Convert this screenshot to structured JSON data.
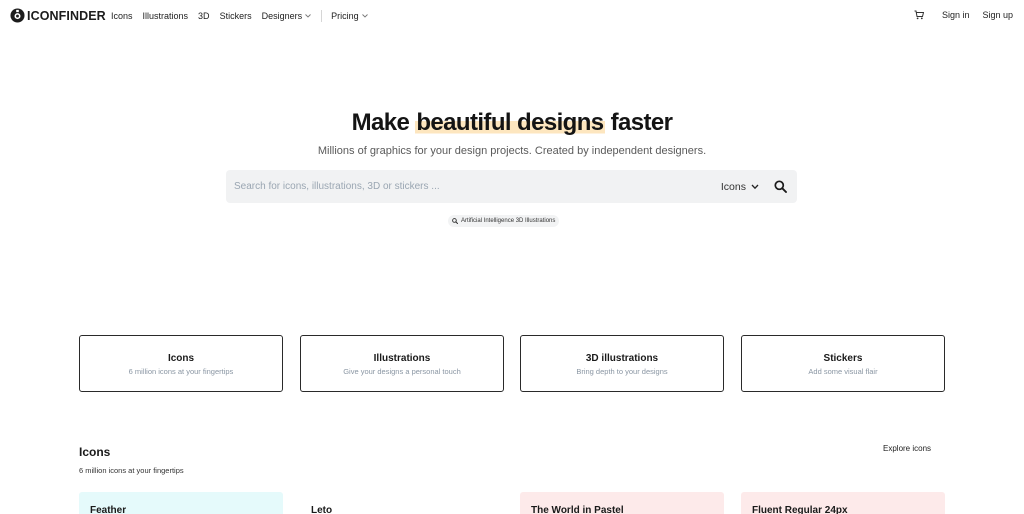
{
  "nav": {
    "logo_text": "ICONFINDER",
    "links": [
      {
        "label": "Icons"
      },
      {
        "label": "Illustrations"
      },
      {
        "label": "3D"
      },
      {
        "label": "Stickers"
      },
      {
        "label": "Designers"
      },
      {
        "label": "Pricing"
      }
    ],
    "signin": "Sign in",
    "signup": "Sign up"
  },
  "hero": {
    "title_pre": "Make ",
    "title_highlight": "beautiful designs",
    "title_post": " faster",
    "subtitle": "Millions of graphics for your design projects. Created by independent designers.",
    "highlight_color": "#fde6bf"
  },
  "search": {
    "placeholder": "Search for icons, illustrations, 3D or stickers ...",
    "value": "",
    "type_selected": "Icons",
    "suggestion": "Artificial Intelligence 3D Illustrations"
  },
  "categories": [
    {
      "title": "Icons",
      "desc": "6 million icons at your fingertips"
    },
    {
      "title": "Illustrations",
      "desc": "Give your designs a personal touch"
    },
    {
      "title": "3D illustrations",
      "desc": "Bring depth to your designs"
    },
    {
      "title": "Stickers",
      "desc": "Add some visual flair"
    }
  ],
  "icons_section": {
    "title": "Icons",
    "subtitle": "6 million icons at your fingertips",
    "explore": "Explore icons",
    "sets": [
      {
        "title": "Feather",
        "bg": "#e5fafb"
      },
      {
        "title": "Leto",
        "bg": "#ffffff"
      },
      {
        "title": "The World in Pastel",
        "bg": "#fdeaea"
      },
      {
        "title": "Fluent Regular 24px",
        "bg": "#fdeaea"
      }
    ]
  }
}
